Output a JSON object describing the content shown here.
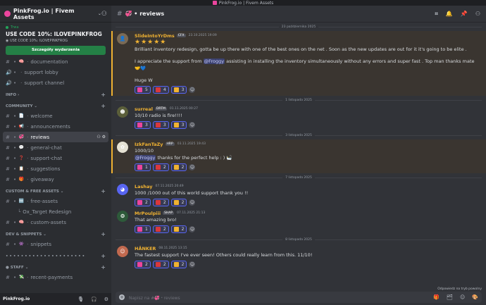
{
  "window": {
    "title": "PinkFrog.io | Fivem Assets"
  },
  "colors": {
    "accent": "#5865f2",
    "pink": "#eb459e",
    "green": "#248046",
    "gold": "#f0b232"
  },
  "server": {
    "name": "PinkFrog.io | Fivem Assets",
    "chevron": "⌄",
    "invite_icon": "⚇"
  },
  "event": {
    "status": "Trwa",
    "title": "USE CODE 10%: ILOVEPINKFROG",
    "location": "USE CODE 10%: ILOVEPINKFROG",
    "button": "Szczegóły wydarzenia"
  },
  "sidebar": {
    "top_channels": [
      {
        "label": "documentation",
        "icon": "🧠",
        "kind": "#"
      },
      {
        "label": "support lobby",
        "icon": "🔊",
        "kind": "voice"
      },
      {
        "label": "support channel",
        "icon": "🔊",
        "kind": "voice"
      }
    ],
    "cat_info": "INFO",
    "cat_community": "COMMUNITY",
    "community": [
      {
        "label": "welcome",
        "icon": "📄"
      },
      {
        "label": "announcements",
        "icon": "📢"
      },
      {
        "label": "reviews",
        "icon": "💞",
        "active": true
      },
      {
        "label": "general-chat",
        "icon": "💬"
      },
      {
        "label": "support-chat",
        "icon": "❓"
      },
      {
        "label": "suggestions",
        "icon": "📋"
      },
      {
        "label": "giveaway",
        "icon": "🎁"
      }
    ],
    "cat_free": "CUSTOM & FREE ASSETS",
    "free": [
      {
        "label": "free-assets",
        "icon": "🆓"
      },
      {
        "label": "Ox_Target Redesign",
        "sub": true
      },
      {
        "label": "custom-assets",
        "icon": "🧠"
      }
    ],
    "cat_dev": "DEV & SNIPPETS",
    "dev": [
      {
        "label": "snippets",
        "icon": "👾"
      }
    ],
    "cat_dots": "• • • • • • • • • • • • • • • • • • • • •",
    "cat_staff": "STAFF",
    "staff": [
      {
        "label": "recent-payments",
        "icon": "💸"
      }
    ],
    "active_tools": "⚇ ⚙"
  },
  "user": {
    "name": "PinkFrog.io",
    "mic": "🎙",
    "headset": "🎧",
    "gear": "⚙"
  },
  "channel": {
    "name": "reviews",
    "icon": "💞",
    "tools": [
      "⌗",
      "🔔",
      "📌",
      "⚇"
    ]
  },
  "messages": [
    {
      "divider": "23 października 2025",
      "author": "SlideIntoYrDms",
      "color": "#f0b232",
      "badge": "CFX",
      "time": "23.10.2025 19:09",
      "avatar_bg": "#7a6a55",
      "avatar_glyph": "👤",
      "highlight": true,
      "stars": "★★★★★",
      "lines": [
        {
          "text": "Brilliant inventory redesign, gotta be up there with one of the best ones on the net . Soon as the new updates are out for it it's going to be elite ."
        },
        {
          "text_before": "I appreciate the support from ",
          "mention": "@Froggy",
          "text_after": " assisting in installing the inventory simultaneously without any errors and super fast . Top man thanks mate 🤝💙",
          "gap": true
        },
        {
          "text": "Huge W",
          "gap": true
        }
      ],
      "reactions": [
        {
          "color": "#eb459e",
          "count": "5"
        },
        {
          "color": "#da373c",
          "count": "4"
        },
        {
          "color": "#f0b232",
          "count": "3"
        }
      ]
    },
    {
      "divider": "1 listopada 2025",
      "author": "surreal",
      "color": "#f0b232",
      "badge": "DRTM",
      "time": "01.11.2025 00:27",
      "avatar_bg": "#5b5f3a",
      "avatar_glyph": "☻",
      "lines": [
        {
          "text": "10/10 radio is fire!!!!"
        }
      ],
      "reactions": [
        {
          "color": "#eb459e",
          "count": "3"
        },
        {
          "color": "#da373c",
          "count": "3"
        },
        {
          "color": "#f0b232",
          "count": "3"
        }
      ]
    },
    {
      "divider": "3 listopada 2025",
      "author": "IzkFanTaZy",
      "color": "#f0b232",
      "badge": "HRP",
      "time": "03.11.2025 19:43",
      "avatar_bg": "#e6e2d3",
      "avatar_glyph": "✿",
      "highlight": true,
      "lines": [
        {
          "text": "1000/10"
        },
        {
          "mention": "@Froggy",
          "text_after": " thanks for the perfect help : ) 🛀"
        }
      ],
      "reactions": [
        {
          "color": "#eb459e",
          "count": "1"
        },
        {
          "color": "#da373c",
          "count": "2"
        },
        {
          "color": "#f0b232",
          "count": "2"
        }
      ]
    },
    {
      "divider": "7 listopada 2025",
      "author": "Lashay",
      "color": "#f0b232",
      "badge": "",
      "time": "07.11.2025 20:49",
      "avatar_bg": "#5865f2",
      "avatar_glyph": "◕",
      "lines": [
        {
          "text": "1000 /1000 out of this world support thank you !!"
        }
      ],
      "reactions": [
        {
          "color": "#eb459e",
          "count": "2"
        },
        {
          "color": "#da373c",
          "count": "2"
        },
        {
          "color": "#f0b232",
          "count": "2"
        }
      ]
    },
    {
      "divider": "",
      "author": "MrPoulpiii",
      "color": "#f0b232",
      "badge": "SHAP",
      "time": "07.11.2025 21:13",
      "avatar_bg": "#2d5a3a",
      "avatar_glyph": "❂",
      "lines": [
        {
          "text": "That amazing bro!"
        }
      ],
      "reactions": [
        {
          "color": "#eb459e",
          "count": "1"
        },
        {
          "color": "#da373c",
          "count": "2"
        },
        {
          "color": "#f0b232",
          "count": "2"
        }
      ]
    },
    {
      "divider": "8 listopada 2025",
      "author": "HÄNKER",
      "color": "#f0b232",
      "badge": "",
      "time": "08.11.2025 13:15",
      "avatar_bg": "#c1694f",
      "avatar_glyph": "☺",
      "lines": [
        {
          "text": "The fastest support I've ever seen! Others could really learn from this. 11/10!"
        }
      ],
      "reactions": [
        {
          "color": "#eb459e",
          "count": "2"
        },
        {
          "color": "#da373c",
          "count": "2"
        },
        {
          "color": "#f0b232",
          "count": "2"
        }
      ]
    }
  ],
  "slowmode": "Odpowiedz na tryb powolny",
  "composer": {
    "placeholder": "Napisz na #💞・reviews",
    "tools": [
      "🎁",
      "🗂",
      "☺",
      "🎨"
    ]
  }
}
